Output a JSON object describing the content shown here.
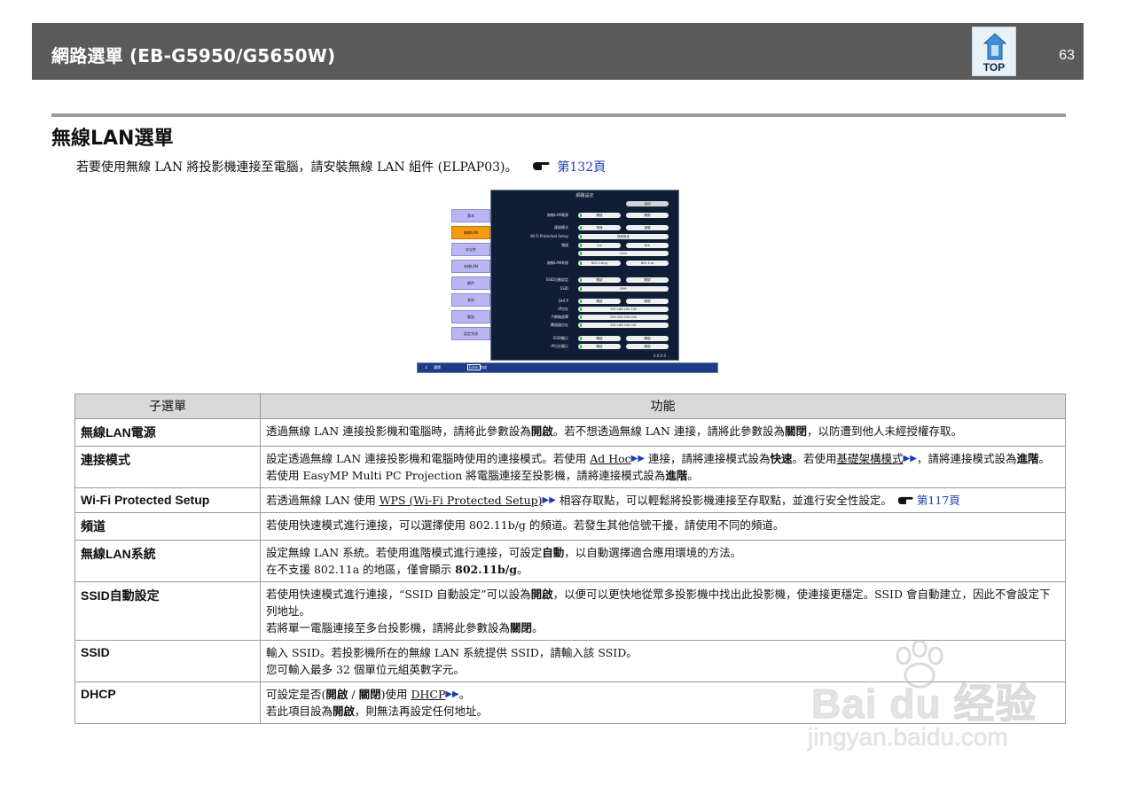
{
  "header": {
    "title": "網路選單 (EB-G5950/G5650W)",
    "top_label": "TOP",
    "page_number": "63"
  },
  "section": {
    "title": "無線LAN選單",
    "intro_text": "若要使用無線  LAN  將投影機連接至電腦，請安裝無線  LAN  組件  (ELPAP03)。",
    "intro_link": "第132頁"
  },
  "menu_screenshot": {
    "panel_title": "網路設定",
    "side_items": [
      "基本",
      "無線LAN",
      "安全性",
      "有線LAN",
      "郵件",
      "其他",
      "重設",
      "設定完成"
    ],
    "return_label": "返回",
    "rows": [
      {
        "label": "無線LAN電源",
        "opts": [
          "開啟",
          "關閉"
        ]
      },
      {
        "label": "連接模式",
        "opts": [
          "快速",
          "進階"
        ]
      },
      {
        "label": "Wi-Fi Protected Setup",
        "opts": [
          "按鈕設定"
        ]
      },
      {
        "label": "頻道",
        "opts": [
          "1ch",
          "6ch"
        ]
      },
      {
        "label": "",
        "opts": [
          "11ch"
        ]
      },
      {
        "label": "無線LAN系統",
        "opts": [
          "802.11b/g",
          "802.11a"
        ]
      },
      {
        "label": "SSID自動設定",
        "opts": [
          "開啟",
          "關閉"
        ]
      },
      {
        "label": "SSID",
        "opts": [
          "EMP"
        ]
      },
      {
        "label": "DHCP",
        "opts": [
          "開啟",
          "關閉"
        ]
      },
      {
        "label": "IP位址",
        "opts": [
          "192.168.200.100"
        ]
      },
      {
        "label": "子網路遮罩",
        "opts": [
          "255.255.255.000"
        ]
      },
      {
        "label": "閘道器位址",
        "opts": [
          "192.168.200.001"
        ]
      },
      {
        "label": "SSID顯示",
        "opts": [
          "開啟",
          "關閉"
        ]
      },
      {
        "label": "IP位址顯示",
        "opts": [
          "開啟",
          "關閉"
        ]
      }
    ],
    "version": "0.0.0.0",
    "footer_select": "選擇",
    "footer_enter": "Enter",
    "footer_end": "完成"
  },
  "table": {
    "col_submenu": "子選單",
    "col_function": "功能",
    "rows": [
      {
        "name": "無線LAN電源",
        "lines": [
          [
            "透過無線 LAN 連接投影機和電腦時，請將此參數設為",
            "開啟",
            "。若不想透過無線 LAN 連接，請將此參數設為",
            "關閉",
            "，以防遭到他人未經授權存取。"
          ]
        ]
      },
      {
        "name": "連接模式",
        "lines": [
          [
            "設定透過無線 LAN 連接投影機和電腦時使用的連接模式。若使用 ",
            "Ad Hoc",
            " 連接，請將連接模式設為",
            "快速",
            "。若使用",
            "基礎架構模式",
            "，請將連接模式設為",
            "進階",
            "。若使用 EasyMP Multi PC Projection 將電腦連接至投影機，請將連接模式設為",
            "進階",
            "。"
          ]
        ]
      },
      {
        "name": "Wi-Fi Protected Setup",
        "lines": [
          [
            "若透過無線 LAN 使用 ",
            "WPS (Wi-Fi Protected Setup)",
            " 相容存取點，可以輕鬆將投影機連接至存取點，並進行安全性設定。",
            "第117頁"
          ]
        ]
      },
      {
        "name": "頻道",
        "lines": [
          [
            "若使用快速模式進行連接，可以選擇使用 802.11b/g 的頻道。若發生其他信號干擾，請使用不同的頻道。"
          ]
        ]
      },
      {
        "name": "無線LAN系統",
        "lines": [
          [
            "設定無線 LAN 系統。若使用進階模式進行連接，可設定",
            "自動",
            "，以自動選擇適合應用環境的方法。"
          ],
          [
            "在不支援 802.11a 的地區，僅會顯示 ",
            "802.11b/g",
            "。"
          ]
        ]
      },
      {
        "name": "SSID自動設定",
        "lines": [
          [
            "若使用快速模式進行連接，“SSID 自動設定”可以設為",
            "開啟",
            "，以便可以更快地從眾多投影機中找出此投影機，使連接更穩定。SSID 會自動建立，因此不會設定下列地址。"
          ],
          [
            "若將單一電腦連接至多台投影機，請將此參數設為",
            "關閉",
            "。"
          ]
        ]
      },
      {
        "name": "SSID",
        "lines": [
          [
            "輸入 SSID。若投影機所在的無線 LAN 系統提供 SSID，請輸入該 SSID。"
          ],
          [
            "您可輸入最多 32 個單位元組英數字元。"
          ]
        ]
      },
      {
        "name": "DHCP",
        "lines": [
          [
            "可設定是否(",
            "開啟",
            " / ",
            "關閉",
            ")使用 ",
            "DHCP",
            "。"
          ],
          [
            "若此項目設為",
            "開啟",
            "，則無法再設定任何地址。"
          ]
        ]
      }
    ]
  },
  "watermark": {
    "brand": "Bai du 经验",
    "url": "jingyan.baidu.com"
  }
}
